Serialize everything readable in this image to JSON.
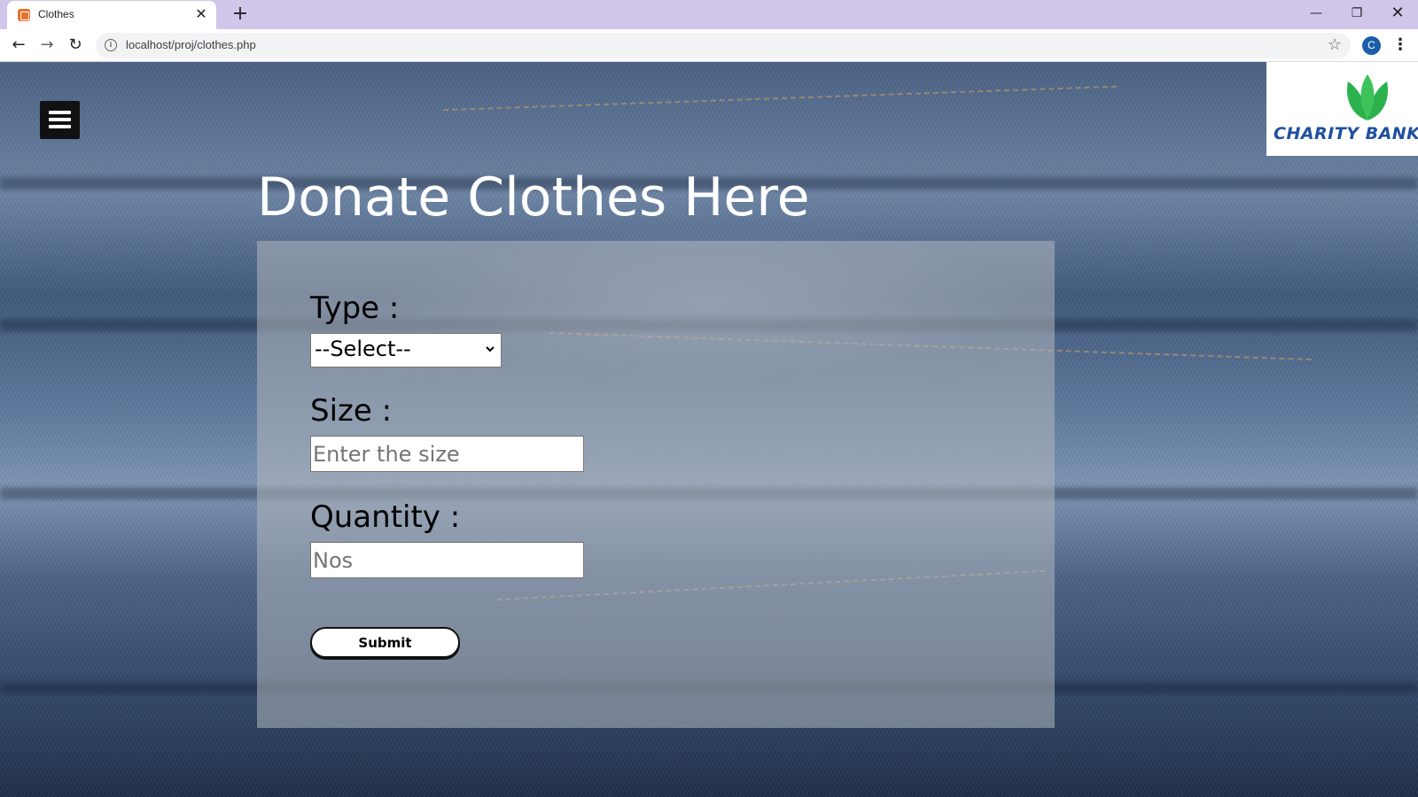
{
  "browser": {
    "tab_title": "Clothes",
    "tab_close": "✕",
    "new_tab": "+",
    "url": "localhost/proj/clothes.php",
    "profile_initial": "C",
    "window": {
      "minimize": "—",
      "restore": "❐",
      "close": "✕"
    }
  },
  "page": {
    "heading": "Donate Clothes Here",
    "logo_text": "CHARITY BANK",
    "form": {
      "type_label": "Type :",
      "type_selected": "--Select--",
      "size_label": "Size :",
      "size_placeholder": "Enter the size",
      "quantity_label": "Quantity :",
      "quantity_placeholder": "Nos",
      "submit_label": "Submit"
    }
  },
  "colors": {
    "tab_strip": "#d2c5ea",
    "logo_green": "#2bb24c",
    "logo_blue": "#1f4fa0",
    "denim": "#4a6183"
  },
  "icons": [
    "favicon-icon",
    "close-icon",
    "plus-icon",
    "back-arrow-icon",
    "forward-arrow-icon",
    "reload-icon",
    "info-icon",
    "star-icon",
    "kebab-menu-icon",
    "hamburger-menu-icon",
    "chevron-down-icon",
    "leaf-logo-icon"
  ]
}
